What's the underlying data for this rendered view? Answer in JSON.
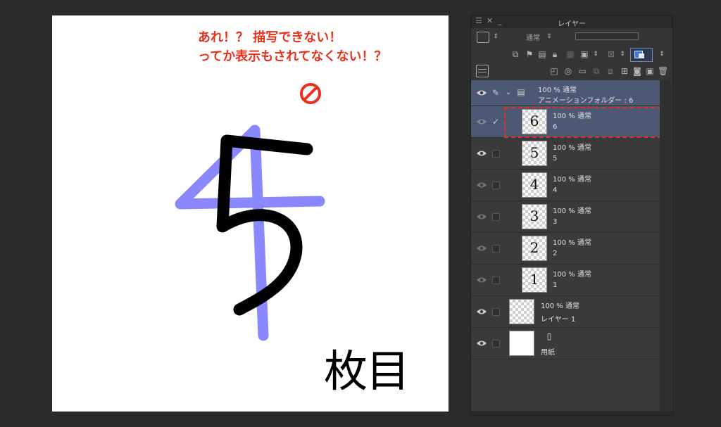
{
  "canvas": {
    "annotation_line1": "あれ！？ 描写できない！",
    "annotation_line2": "ってか表示もされてなくない！？",
    "big_number": "5",
    "big_label": "枚目",
    "colors": {
      "annotation": "#e8301c",
      "onion_skin": "#8a88ff",
      "stroke": "#000000"
    }
  },
  "panel": {
    "title": "レイヤー",
    "blend_mode": "通常",
    "layers": [
      {
        "name": "アニメーションフォルダー : 6",
        "props": "100 % 通常",
        "type": "folder"
      },
      {
        "name": "6",
        "props": "100 % 通常",
        "thumb": "6",
        "selected": true
      },
      {
        "name": "5",
        "props": "100 % 通常",
        "thumb": "5"
      },
      {
        "name": "4",
        "props": "100 % 通常",
        "thumb": "4"
      },
      {
        "name": "3",
        "props": "100 % 通常",
        "thumb": "3"
      },
      {
        "name": "2",
        "props": "100 % 通常",
        "thumb": "2"
      },
      {
        "name": "1",
        "props": "100 % 通常",
        "thumb": "1"
      },
      {
        "name": "レイヤー 1",
        "props": "100 % 通常"
      },
      {
        "name": "用紙",
        "props": ""
      }
    ],
    "colors": {
      "selected_row": "#4d5875",
      "highlight_dash": "#e03020"
    }
  }
}
